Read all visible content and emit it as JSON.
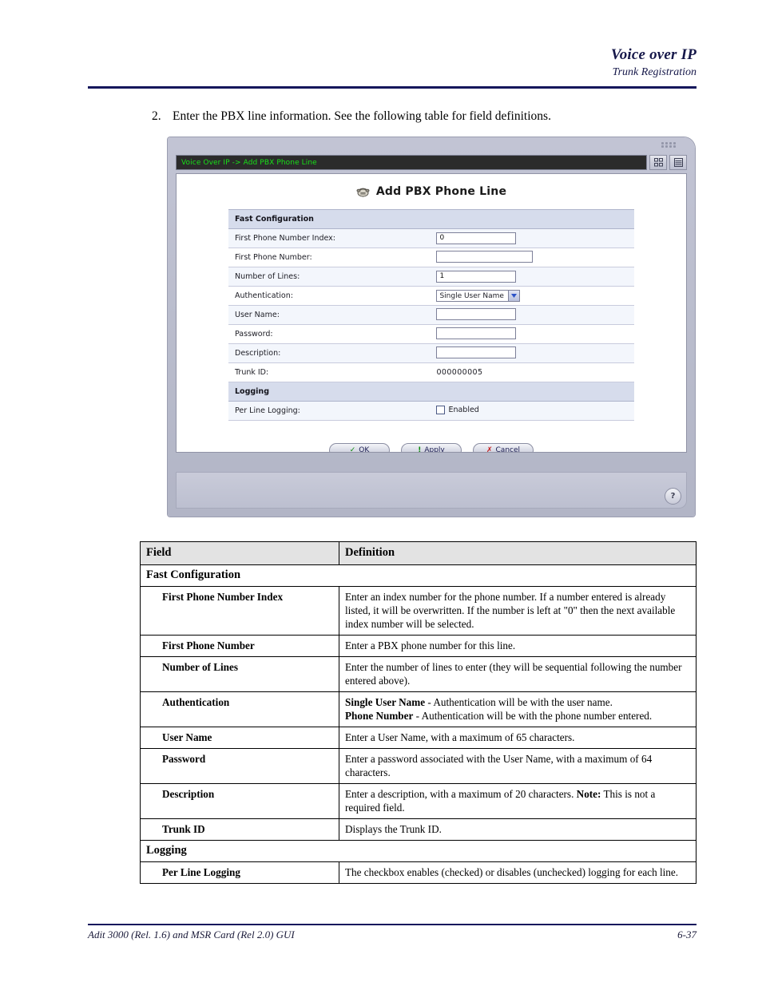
{
  "page_header": {
    "title": "Voice over IP",
    "subtitle": "Trunk Registration"
  },
  "step": {
    "number": "2.",
    "text": "Enter the PBX line information.  See the following table for field definitions."
  },
  "app_window": {
    "breadcrumb": "Voice Over IP -> Add PBX Phone Line",
    "screen_title": "Add PBX Phone Line",
    "help_label": "?",
    "form": {
      "sections": [
        {
          "name": "Fast Configuration",
          "rows": [
            {
              "label": "First Phone Number Index:",
              "type": "text",
              "value": "0",
              "width": "w-sm"
            },
            {
              "label": "First Phone Number:",
              "type": "text",
              "value": "",
              "width": "w-md"
            },
            {
              "label": "Number of Lines:",
              "type": "text",
              "value": "1",
              "width": "w-sm"
            },
            {
              "label": "Authentication:",
              "type": "select",
              "value": "Single User Name"
            },
            {
              "label": "User Name:",
              "type": "text",
              "value": "",
              "width": "w-sm"
            },
            {
              "label": "Password:",
              "type": "text",
              "value": "",
              "width": "w-sm"
            },
            {
              "label": "Description:",
              "type": "text",
              "value": "",
              "width": "w-sm"
            },
            {
              "label": "Trunk ID:",
              "type": "static",
              "value": "000000005"
            }
          ]
        },
        {
          "name": "Logging",
          "rows": [
            {
              "label": "Per Line Logging:",
              "type": "checkbox",
              "value": "Enabled",
              "checked": false
            }
          ]
        }
      ]
    },
    "buttons": [
      {
        "label": "OK",
        "mark": "✓",
        "mark_class": "mark-ok"
      },
      {
        "label": "Apply",
        "mark": "!",
        "mark_class": "mark-apply"
      },
      {
        "label": "Cancel",
        "mark": "✗",
        "mark_class": "mark-cancel"
      }
    ]
  },
  "definitions_table": {
    "headers": {
      "field": "Field",
      "definition": "Definition"
    },
    "rows": [
      {
        "kind": "group",
        "field": "Fast Configuration"
      },
      {
        "kind": "item",
        "field": "First Phone Number Index",
        "definition": "Enter an index number for the phone number. If a number entered is already listed, it will be overwritten. If the number is left at \"0\" then the next available index number will be selected."
      },
      {
        "kind": "item",
        "field": "First Phone Number",
        "definition": "Enter a PBX phone number for this line."
      },
      {
        "kind": "item",
        "field": "Number of Lines",
        "definition": "Enter the number of lines to enter (they will be sequential following the number entered above)."
      },
      {
        "kind": "item_rich",
        "field": "Authentication",
        "definition_html": "<b>Single User Name</b> - Authentication will be with the user name.<br><b>Phone Number</b> - Authentication will be with the phone number entered."
      },
      {
        "kind": "item",
        "field": "User Name",
        "definition": "Enter a User Name, with a maximum of 65 characters."
      },
      {
        "kind": "item",
        "field": "Password",
        "definition": "Enter a password associated with the User Name, with a maximum of 64 characters."
      },
      {
        "kind": "item_rich",
        "field": "Description",
        "definition_html": "Enter a description, with a maximum of 20 characters. <b>Note:</b> This is not a required field."
      },
      {
        "kind": "item",
        "field": "Trunk ID",
        "definition": "Displays the Trunk ID."
      },
      {
        "kind": "group",
        "field": "Logging"
      },
      {
        "kind": "item",
        "field": "Per Line Logging",
        "definition": "The checkbox enables (checked) or disables (unchecked) logging for each line."
      }
    ]
  },
  "footer": {
    "left": "Adit 3000 (Rel. 1.6) and MSR Card (Rel 2.0) GUI",
    "right": "6-37"
  },
  "colors": {
    "header_rule": "#15175c",
    "breadcrumb_text": "#18e018",
    "breadcrumb_bg": "#2b2b2b",
    "section_bg": "#d6dcec",
    "row_alt_bg": "#f3f6fc"
  }
}
